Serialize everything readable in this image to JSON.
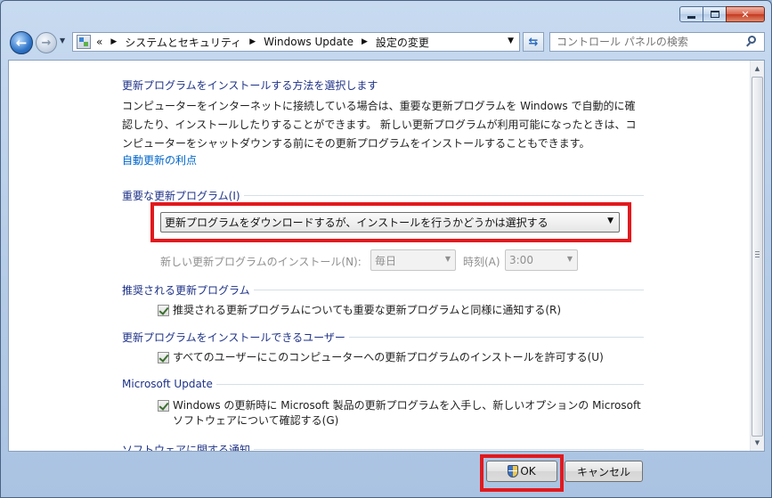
{
  "window": {
    "caption_buttons": [
      "minimize",
      "maximize",
      "close"
    ]
  },
  "nav": {
    "back_icon": "back-arrow-icon",
    "forward_icon": "forward-arrow-icon",
    "address": {
      "overflow": "«",
      "crumbs": [
        "システムとセキュリティ",
        "Windows Update",
        "設定の変更"
      ]
    },
    "search_placeholder": "コントロール パネルの検索"
  },
  "content": {
    "title": "更新プログラムをインストールする方法を選択します",
    "intro_lines": [
      "コンピューターをインターネットに接続している場合は、重要な更新プログラムを Windows で自動的に確",
      "認したり、インストールしたりすることができます。 新しい更新プログラムが利用可能になったときは、コ",
      "ンピューターをシャットダウンする前にその更新プログラムをインストールすることもできます。"
    ],
    "link": "自動更新の利点",
    "important": {
      "heading": "重要な更新プログラム(I)",
      "selected": "更新プログラムをダウンロードするが、インストールを行うかどうかは選択する",
      "schedule_label": "新しい更新プログラムのインストール(N):",
      "day": "毎日",
      "time_label": "時刻(A)",
      "time": "3:00"
    },
    "recommended": {
      "heading": "推奨される更新プログラム",
      "checkbox_label": "推奨される更新プログラムについても重要な更新プログラムと同様に通知する(R)",
      "checked": true
    },
    "users": {
      "heading": "更新プログラムをインストールできるユーザー",
      "checkbox_label": "すべてのユーザーにこのコンピューターへの更新プログラムのインストールを許可する(U)",
      "checked": true
    },
    "microsoft_update": {
      "heading": "Microsoft Update",
      "checkbox_lines": [
        "Windows の更新時に Microsoft 製品の更新プログラムを入手し、新しいオプションの Microsoft",
        "ソフトウェアについて確認する(G)"
      ],
      "checked": true
    },
    "software_notice": {
      "heading": "ソフトウェアに関する通知"
    }
  },
  "buttons": {
    "ok": "OK",
    "cancel": "キャンセル"
  },
  "colors": {
    "highlight": "#e2191d",
    "heading": "#1e3287",
    "link": "#0066cc"
  }
}
